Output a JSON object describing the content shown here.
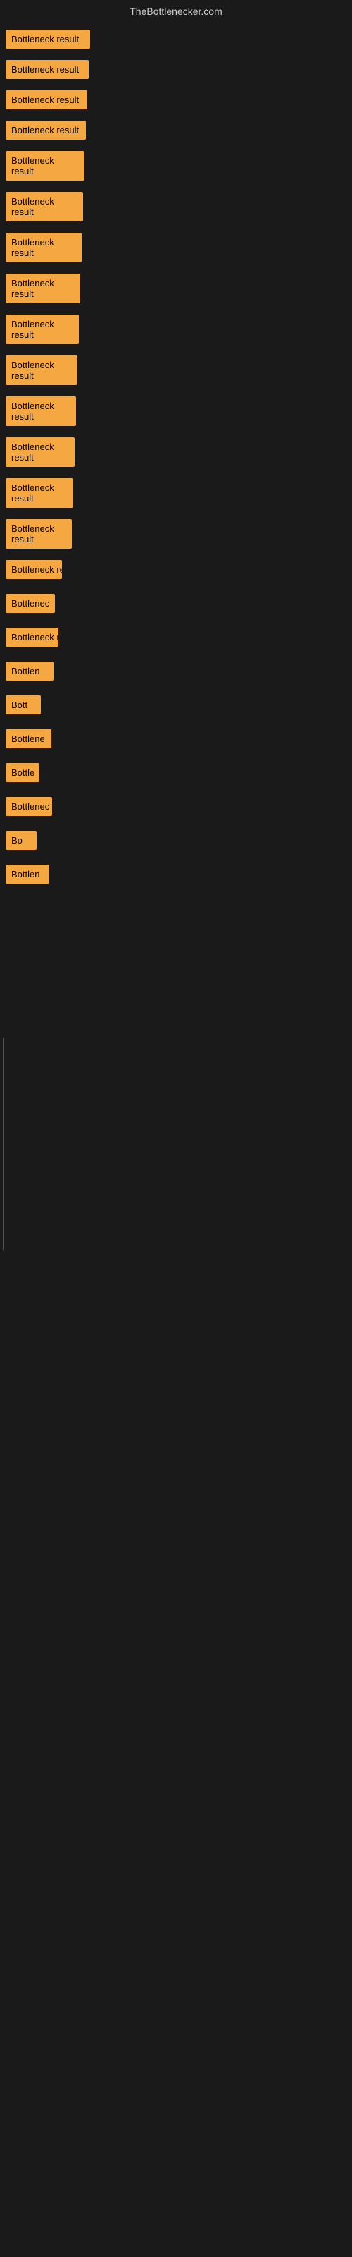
{
  "site": {
    "title": "TheBottlenecker.com"
  },
  "items": [
    {
      "id": 1,
      "label": "Bottleneck result",
      "sizeClass": "item-1"
    },
    {
      "id": 2,
      "label": "Bottleneck result",
      "sizeClass": "item-2"
    },
    {
      "id": 3,
      "label": "Bottleneck result",
      "sizeClass": "item-3"
    },
    {
      "id": 4,
      "label": "Bottleneck result",
      "sizeClass": "item-4"
    },
    {
      "id": 5,
      "label": "Bottleneck result",
      "sizeClass": "item-5"
    },
    {
      "id": 6,
      "label": "Bottleneck result",
      "sizeClass": "item-6"
    },
    {
      "id": 7,
      "label": "Bottleneck result",
      "sizeClass": "item-7"
    },
    {
      "id": 8,
      "label": "Bottleneck result",
      "sizeClass": "item-8"
    },
    {
      "id": 9,
      "label": "Bottleneck result",
      "sizeClass": "item-9"
    },
    {
      "id": 10,
      "label": "Bottleneck result",
      "sizeClass": "item-10"
    },
    {
      "id": 11,
      "label": "Bottleneck result",
      "sizeClass": "item-11"
    },
    {
      "id": 12,
      "label": "Bottleneck result",
      "sizeClass": "item-12"
    },
    {
      "id": 13,
      "label": "Bottleneck result",
      "sizeClass": "item-13"
    },
    {
      "id": 14,
      "label": "Bottleneck result",
      "sizeClass": "item-14"
    },
    {
      "id": 15,
      "label": "Bottleneck result",
      "sizeClass": "item-15"
    },
    {
      "id": 16,
      "label": "Bottleneck result",
      "sizeClass": "item-16"
    },
    {
      "id": 17,
      "label": "Bottleneck r",
      "sizeClass": "item-17"
    },
    {
      "id": 18,
      "label": "Bottleneck result",
      "sizeClass": "item-18"
    },
    {
      "id": 19,
      "label": "Bottlen",
      "sizeClass": "item-19"
    },
    {
      "id": 20,
      "label": "Bott",
      "sizeClass": "item-20"
    },
    {
      "id": 21,
      "label": "Bottlene",
      "sizeClass": "item-21"
    },
    {
      "id": 22,
      "label": "Bottle",
      "sizeClass": "item-22"
    },
    {
      "id": 23,
      "label": "Bottlenec",
      "sizeClass": "item-23"
    },
    {
      "id": 24,
      "label": "Bo",
      "sizeClass": "item-24"
    },
    {
      "id": 25,
      "label": "Bottlen",
      "sizeClass": "item-21"
    }
  ]
}
